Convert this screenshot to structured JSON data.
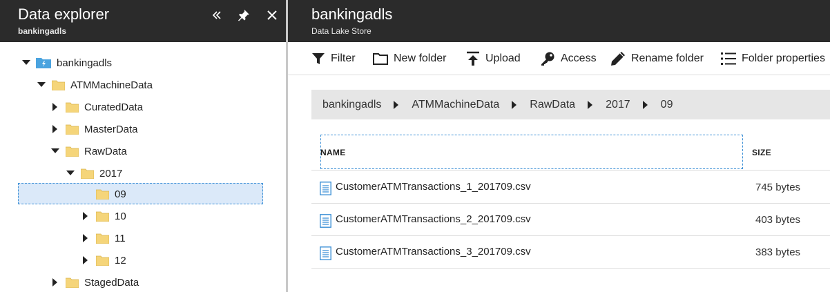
{
  "explorer": {
    "title": "Data explorer",
    "subtitle": "bankingadls",
    "tree": [
      {
        "label": "bankingadls",
        "icon": "adls-store-icon"
      },
      {
        "label": "ATMMachineData",
        "icon": "folder-icon"
      },
      {
        "label": "CuratedData",
        "icon": "folder-icon"
      },
      {
        "label": "MasterData",
        "icon": "folder-icon"
      },
      {
        "label": "RawData",
        "icon": "folder-icon"
      },
      {
        "label": "2017",
        "icon": "folder-icon"
      },
      {
        "label": "09",
        "icon": "folder-icon",
        "selected": true
      },
      {
        "label": "10",
        "icon": "folder-icon"
      },
      {
        "label": "11",
        "icon": "folder-icon"
      },
      {
        "label": "12",
        "icon": "folder-icon"
      },
      {
        "label": "StagedData",
        "icon": "folder-icon"
      }
    ]
  },
  "content": {
    "title": "bankingadls",
    "subtitle": "Data Lake Store",
    "toolbar": {
      "filter": "Filter",
      "new_folder": "New folder",
      "upload": "Upload",
      "access": "Access",
      "rename_folder": "Rename folder",
      "folder_properties": "Folder properties"
    },
    "breadcrumb": [
      "bankingadls",
      "ATMMachineData",
      "RawData",
      "2017",
      "09"
    ],
    "columns": {
      "name": "NAME",
      "size": "SIZE"
    },
    "files": [
      {
        "name": "CustomerATMTransactions_1_201709.csv",
        "size": "745 bytes"
      },
      {
        "name": "CustomerATMTransactions_2_201709.csv",
        "size": "403 bytes"
      },
      {
        "name": "CustomerATMTransactions_3_201709.csv",
        "size": "383 bytes"
      }
    ]
  },
  "colors": {
    "header_bg": "#2b2b2b",
    "folder": "#f5d57a",
    "selected_bg": "#dbe9f9",
    "accent": "#3b8fd6"
  }
}
